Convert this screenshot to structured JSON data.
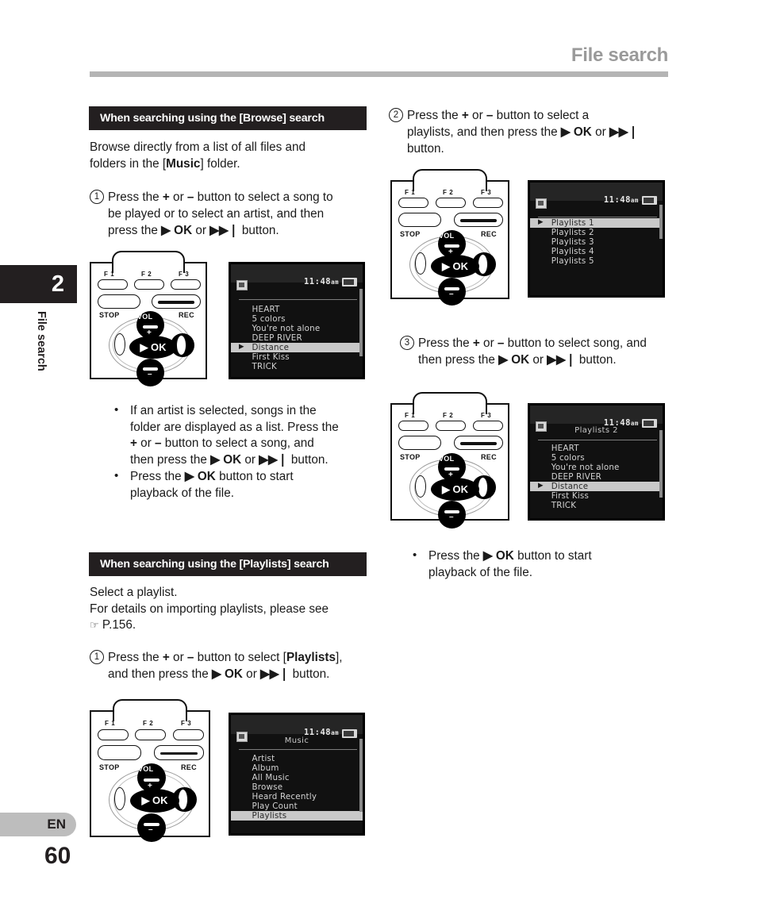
{
  "header": {
    "title": "File search"
  },
  "sidebar": {
    "chapter_number": "2",
    "chapter_label": "File search",
    "language": "EN",
    "page_number": "60"
  },
  "left_column": {
    "section1": {
      "bar_label": "When searching using the [Browse] search",
      "intro_line1": "Browse directly from a list of all files and",
      "intro_line2_pre": "folders in the [",
      "intro_line2_bold": "Music",
      "intro_line2_post": "] folder.",
      "step1": {
        "number": "1",
        "line1_a": "Press the ",
        "line1_plus": "+",
        "line1_b": " or ",
        "line1_minus": "–",
        "line1_c": " button to select a song to",
        "line2": "be played or to select an artist, and then",
        "line3_a": "press the ",
        "line3_ok": "▶ OK",
        "line3_b": " or ",
        "line3_skip": "▶▶❘",
        "line3_c": " button."
      },
      "figure": {
        "device_labels": {
          "f1": "F 1",
          "f2": "F 2",
          "f3": "F 3",
          "stop": "STOP",
          "rec": "REC",
          "vol": "VOL",
          "ok": "▶ OK",
          "plus": "+",
          "minus": "–"
        },
        "lcd": {
          "time": "11:48",
          "time_suffix": "am",
          "title": "",
          "rows": [
            {
              "label": "HEART",
              "selected": false
            },
            {
              "label": "5 colors",
              "selected": false
            },
            {
              "label": "You're not alone",
              "selected": false
            },
            {
              "label": "DEEP RIVER",
              "selected": false
            },
            {
              "label": "Distance",
              "selected": true
            },
            {
              "label": "First Kiss",
              "selected": false
            },
            {
              "label": "TRICK",
              "selected": false
            }
          ]
        }
      },
      "bullets": [
        {
          "line1": "If an artist is selected, songs in the",
          "line2": "folder are displayed as a list. Press the",
          "line3_a": "+",
          "line3_b": " or ",
          "line3_c": "–",
          "line3_d": " button to select a song, and",
          "line4_a": "then press the ",
          "line4_ok": "▶ OK",
          "line4_b": " or ",
          "line4_skip": "▶▶❘",
          "line4_c": " button."
        },
        {
          "line1_a": "Press the ",
          "line1_ok": "▶ OK",
          "line1_b": " button to start",
          "line2": "playback of the file."
        }
      ]
    },
    "section2": {
      "bar_label": "When searching using the [Playlists] search",
      "intro_line1": "Select a playlist.",
      "intro_line2": "For details on importing playlists, please see",
      "intro_line3_icon": "☞",
      "intro_line3": "P.156.",
      "step1": {
        "number": "1",
        "line1_a": "Press the ",
        "line1_plus": "+",
        "line1_b": " or ",
        "line1_minus": "–",
        "line1_c": " button to select [",
        "line1_bold": "Playlists",
        "line1_d": "],",
        "line2_a": "and then press the ",
        "line2_ok": "▶ OK",
        "line2_b": " or ",
        "line2_skip": "▶▶❘",
        "line2_c": " button."
      },
      "figure": {
        "lcd": {
          "time": "11:48",
          "time_suffix": "am",
          "title": "Music",
          "rows": [
            {
              "label": "Artist",
              "selected": false
            },
            {
              "label": "Album",
              "selected": false
            },
            {
              "label": "All Music",
              "selected": false
            },
            {
              "label": "Browse",
              "selected": false
            },
            {
              "label": "Heard Recently",
              "selected": false
            },
            {
              "label": "Play Count",
              "selected": false
            },
            {
              "label": "Playlists",
              "selected": true
            }
          ]
        }
      }
    }
  },
  "right_column": {
    "step2": {
      "number": "2",
      "line1_a": "Press the ",
      "line1_plus": "+",
      "line1_b": " or ",
      "line1_minus": "–",
      "line1_c": " button to select a",
      "line2_a": "playlists, and then press the ",
      "line2_ok": "▶ OK",
      "line2_b": " or ",
      "line2_skip": "▶▶❘",
      "line3": "button."
    },
    "figure2": {
      "lcd": {
        "time": "11:48",
        "time_suffix": "am",
        "title": "",
        "rows": [
          {
            "label": "Playlists 1",
            "selected": true
          },
          {
            "label": "Playlists 2",
            "selected": false
          },
          {
            "label": "Playlists 3",
            "selected": false
          },
          {
            "label": "Playlists 4",
            "selected": false
          },
          {
            "label": "Playlists 5",
            "selected": false
          }
        ]
      }
    },
    "step3": {
      "number": "3",
      "line1_a": "Press the ",
      "line1_plus": "+",
      "line1_b": " or ",
      "line1_minus": "–",
      "line1_c": " button to select song, and",
      "line2_a": "then press the ",
      "line2_ok": "▶ OK",
      "line2_b": " or ",
      "line2_skip": "▶▶❘",
      "line2_c": " button."
    },
    "figure3": {
      "lcd": {
        "time": "11:48",
        "time_suffix": "am",
        "title": "Playlists 2",
        "rows": [
          {
            "label": "HEART",
            "selected": false
          },
          {
            "label": "5 colors",
            "selected": false
          },
          {
            "label": "You're not alone",
            "selected": false
          },
          {
            "label": "DEEP RIVER",
            "selected": false
          },
          {
            "label": "Distance",
            "selected": true
          },
          {
            "label": "First Kiss",
            "selected": false
          },
          {
            "label": "TRICK",
            "selected": false
          }
        ]
      }
    },
    "bullet": {
      "line1_a": "Press the ",
      "line1_ok": "▶ OK",
      "line1_b": " button to start",
      "line2": "playback of the file."
    }
  }
}
